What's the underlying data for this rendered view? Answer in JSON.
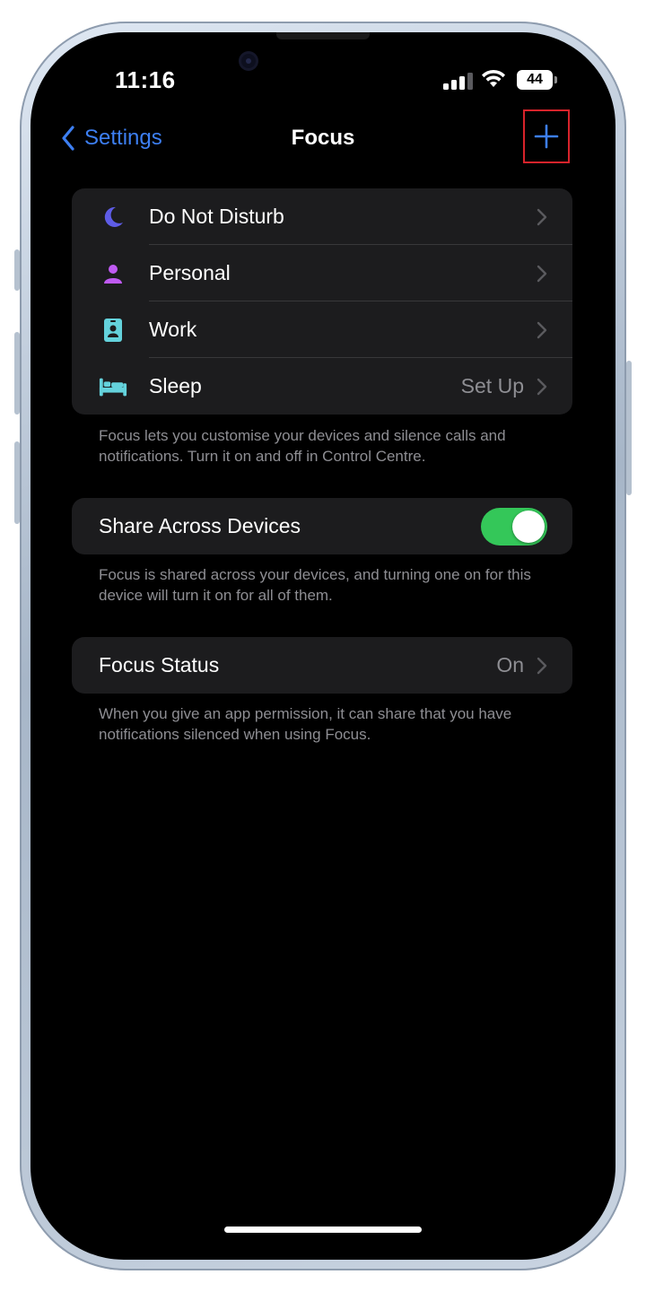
{
  "status_bar": {
    "time": "11:16",
    "battery_level": "44",
    "signal_bars_active": 3,
    "signal_bars_total": 4
  },
  "nav": {
    "back_label": "Settings",
    "title": "Focus",
    "add_icon": "plus-icon"
  },
  "focus_modes": [
    {
      "label": "Do Not Disturb",
      "icon": "moon-icon",
      "color": "#5e5ce6",
      "value": ""
    },
    {
      "label": "Personal",
      "icon": "person-icon",
      "color": "#bf5af2",
      "value": ""
    },
    {
      "label": "Work",
      "icon": "id-badge-icon",
      "color": "#64d2dc",
      "value": ""
    },
    {
      "label": "Sleep",
      "icon": "bed-icon",
      "color": "#64d2dc",
      "value": "Set Up"
    }
  ],
  "focus_footnote": "Focus lets you customise your devices and silence calls and notifications. Turn it on and off in Control Centre.",
  "share": {
    "label": "Share Across Devices",
    "enabled": true,
    "footnote": "Focus is shared across your devices, and turning one on for this device will turn it on for all of them."
  },
  "status": {
    "label": "Focus Status",
    "value": "On",
    "footnote": "When you give an app permission, it can share that you have notifications silenced when using Focus."
  },
  "colors": {
    "accent": "#3d7ff2",
    "toggle_on": "#34c759",
    "cell_background": "#1c1c1e",
    "secondary_text": "#8e8e93",
    "highlight_box": "#d7232b"
  }
}
